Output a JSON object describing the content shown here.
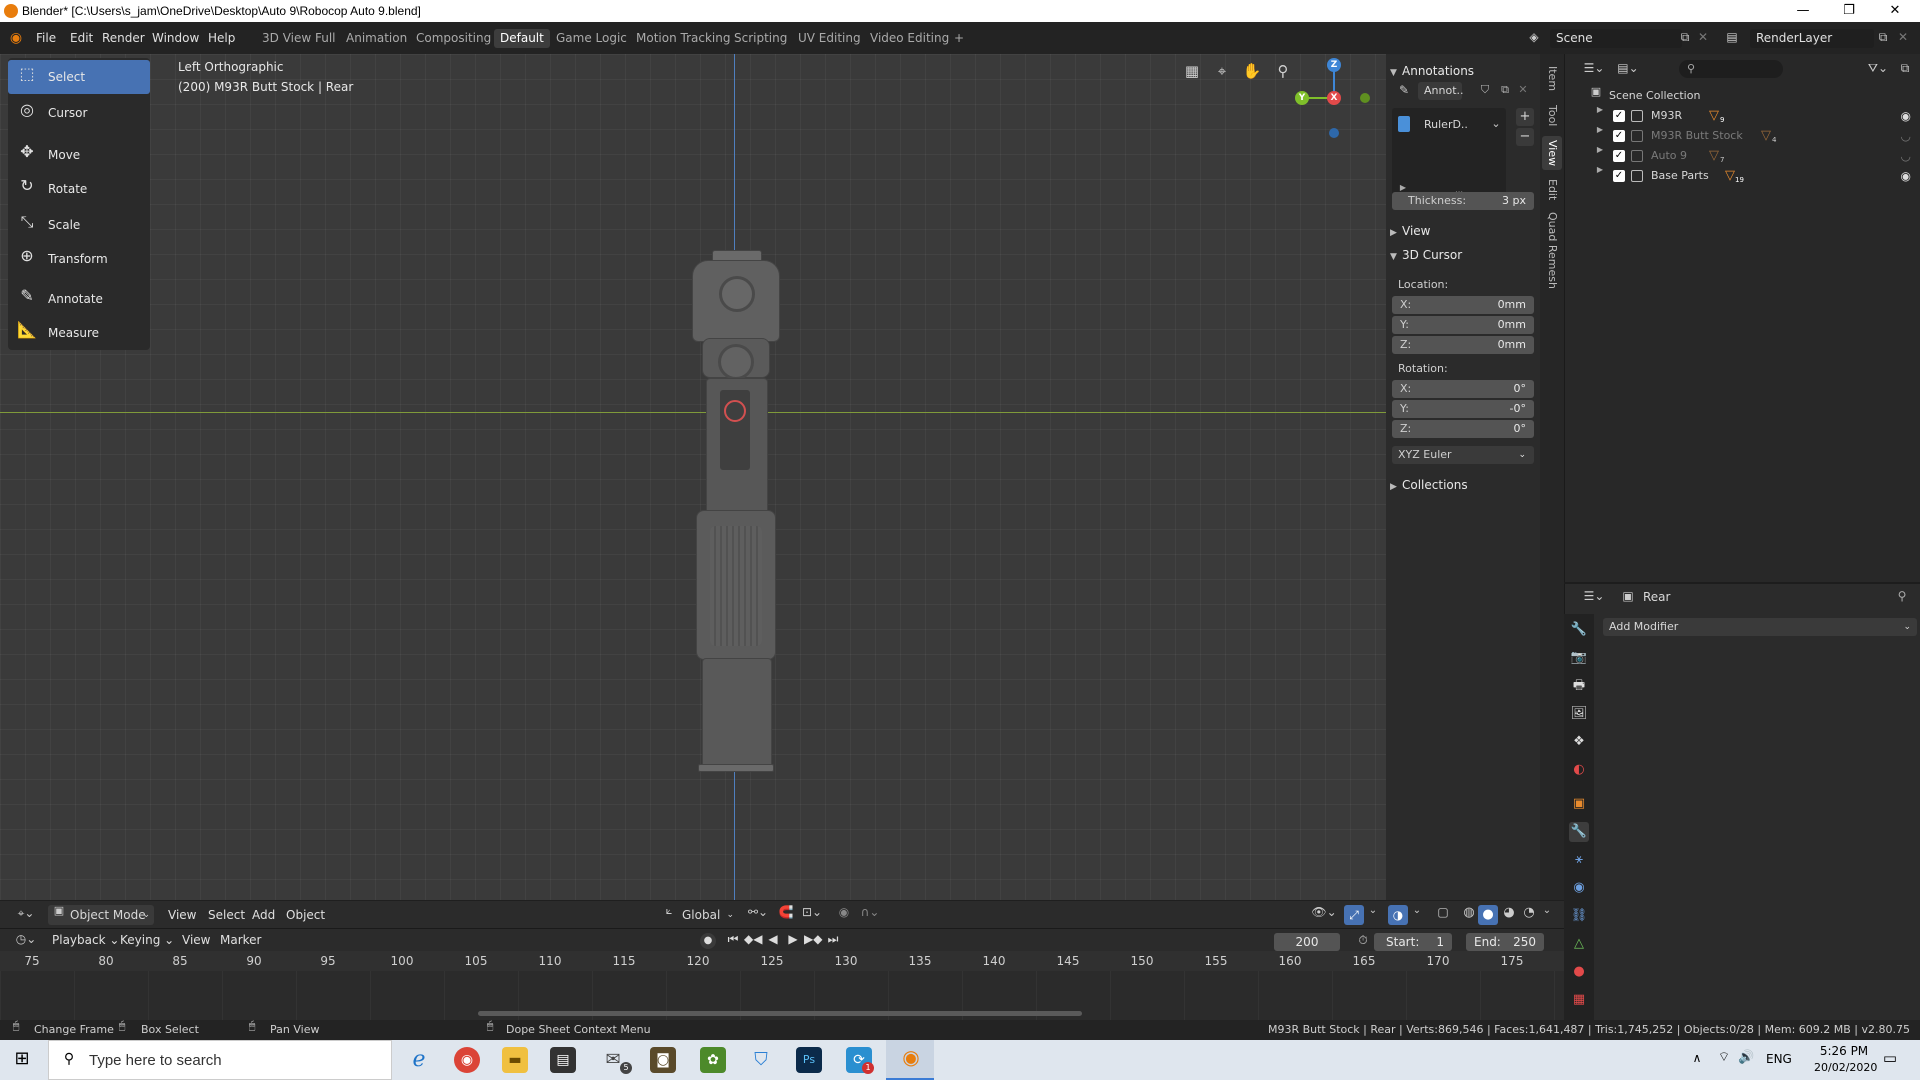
{
  "window": {
    "title": "Blender* [C:\\Users\\s_jam\\OneDrive\\Desktop\\Auto 9\\Robocop Auto 9.blend]",
    "controls": [
      "—",
      "❐",
      "✕"
    ]
  },
  "menu": [
    "File",
    "Edit",
    "Render",
    "Window",
    "Help"
  ],
  "workspaces": {
    "tabs": [
      "3D View Full",
      "Animation",
      "Compositing",
      "Default",
      "Game Logic",
      "Motion Tracking",
      "Scripting",
      "UV Editing",
      "Video Editing"
    ],
    "active": "Default",
    "add": "+"
  },
  "scene": {
    "name": "Scene",
    "view_layer": "RenderLayer"
  },
  "viewport": {
    "view_name": "Left Orthographic",
    "object_info": "(200) M93R Butt Stock | Rear",
    "gizmo": {
      "z": "Z",
      "y": "Y",
      "x": "X"
    }
  },
  "toolbar": {
    "tools": [
      {
        "label": "Select",
        "icon": "select-box-icon",
        "glyph": "⬚",
        "active": true
      },
      {
        "label": "Cursor",
        "icon": "cursor-icon",
        "glyph": "◎",
        "active": false
      },
      {
        "label": "Move",
        "icon": "move-icon",
        "glyph": "✥",
        "active": false
      },
      {
        "label": "Rotate",
        "icon": "rotate-icon",
        "glyph": "↻",
        "active": false
      },
      {
        "label": "Scale",
        "icon": "scale-icon",
        "glyph": "⤡",
        "active": false
      },
      {
        "label": "Transform",
        "icon": "transform-icon",
        "glyph": "⊕",
        "active": false
      },
      {
        "label": "Annotate",
        "icon": "annotate-icon",
        "glyph": "✎",
        "active": false
      },
      {
        "label": "Measure",
        "icon": "measure-icon",
        "glyph": "📐",
        "active": false
      }
    ]
  },
  "npanel": {
    "tabs": [
      "Item",
      "Tool",
      "View",
      "Edit",
      "Quad Remesh"
    ],
    "active_tab": "View",
    "annotations": {
      "title": "Annotations",
      "datablock": "Annot..",
      "layer": "RulerD..",
      "thickness_label": "Thickness:",
      "thickness_value": "3 px"
    },
    "view_title": "View",
    "cursor": {
      "title": "3D Cursor",
      "location_label": "Location:",
      "location": [
        {
          "axis": "X:",
          "value": "0mm"
        },
        {
          "axis": "Y:",
          "value": "0mm"
        },
        {
          "axis": "Z:",
          "value": "0mm"
        }
      ],
      "rotation_label": "Rotation:",
      "rotation": [
        {
          "axis": "X:",
          "value": "0°"
        },
        {
          "axis": "Y:",
          "value": "-0°"
        },
        {
          "axis": "Z:",
          "value": "0°"
        }
      ],
      "rotation_mode": "XYZ Euler"
    },
    "collections_title": "Collections"
  },
  "outliner": {
    "root": "Scene Collection",
    "items": [
      {
        "name": "M93R",
        "badge": "9",
        "dim": false,
        "visible": true
      },
      {
        "name": "M93R Butt Stock",
        "badge": "4",
        "dim": true,
        "visible": false
      },
      {
        "name": "Auto 9",
        "badge": "7",
        "dim": true,
        "visible": false
      },
      {
        "name": "Base Parts",
        "badge": "19",
        "dim": false,
        "visible": true
      }
    ]
  },
  "properties": {
    "object_name": "Rear",
    "add_modifier": "Add Modifier"
  },
  "viewport_header": {
    "mode": "Object Mode",
    "menus": [
      "View",
      "Select",
      "Add",
      "Object"
    ],
    "orientation": "Global"
  },
  "timeline": {
    "menus": [
      "Playback",
      "Keying",
      "View",
      "Marker"
    ],
    "current_frame": "200",
    "start_label": "Start:",
    "start": "1",
    "end_label": "End:",
    "end": "250",
    "ticks": [
      "75",
      "80",
      "85",
      "90",
      "95",
      "100",
      "105",
      "110",
      "115",
      "120",
      "125",
      "130",
      "135",
      "140",
      "145",
      "150",
      "155",
      "160",
      "165",
      "170",
      "175"
    ]
  },
  "statusbar": {
    "left": [
      "Change Frame",
      "Box Select",
      "Pan View",
      "Dope Sheet Context Menu"
    ],
    "right": "M93R Butt Stock | Rear | Verts:869,546 | Faces:1,641,487 | Tris:1,745,252 | Objects:0/28 | Mem: 609.2 MB | v2.80.75"
  },
  "taskbar": {
    "search_placeholder": "Type here to search",
    "language": "ENG",
    "time": "5:26 PM",
    "date": "20/02/2020",
    "mail_badge": "5",
    "app_badge": "1"
  },
  "colors": {
    "accent_blue": "#4772b3",
    "blender_orange": "#e87d0d",
    "axis_x": "#e24a4a",
    "axis_y": "#7fbf2a",
    "axis_z": "#3e86d6"
  }
}
